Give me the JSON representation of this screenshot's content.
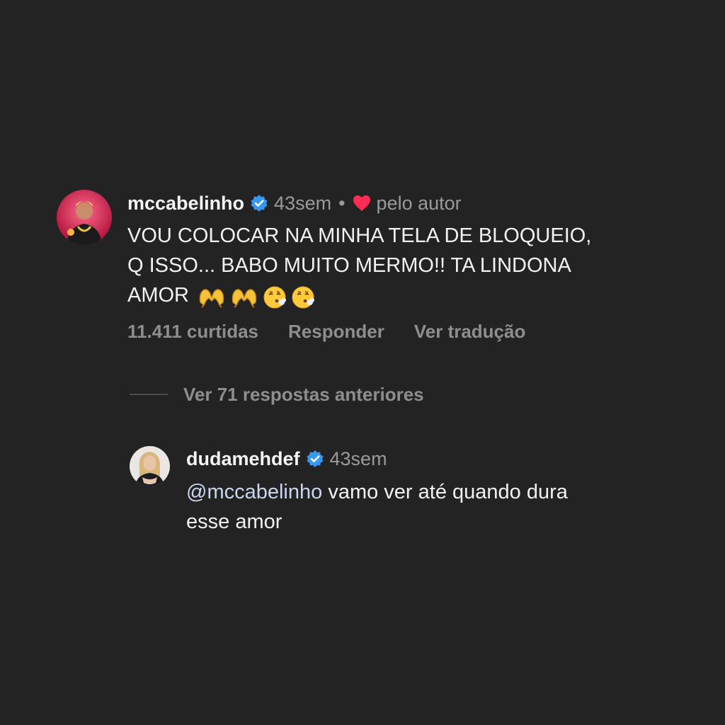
{
  "comment": {
    "username": "mccabelinho",
    "time": "43sem",
    "separator": "•",
    "liked_by": "pelo autor",
    "text_lines": [
      "VOU COLOCAR NA MINHA TELA DE BLOQUEIO,",
      "Q ISSO... BABO MUITO MERMO!! TA LINDONA",
      "AMOR"
    ],
    "emojis": [
      "heart-hands",
      "heart-hands",
      "face-exhaling",
      "face-exhaling"
    ],
    "likes": "11.411 curtidas",
    "reply_label": "Responder",
    "translate_label": "Ver tradução"
  },
  "replies_toggle": {
    "label": "Ver 71 respostas anteriores"
  },
  "reply": {
    "username": "dudamehdef",
    "time": "43sem",
    "mention": "@mccabelinho",
    "text_line1": " vamo ver até quando dura",
    "text_line2": "esse amor"
  },
  "colors": {
    "background": "#232323",
    "verified": "#3897f0",
    "heart": "#ff2d55",
    "muted": "#8e8e8e",
    "mention": "#c9d6f0"
  }
}
